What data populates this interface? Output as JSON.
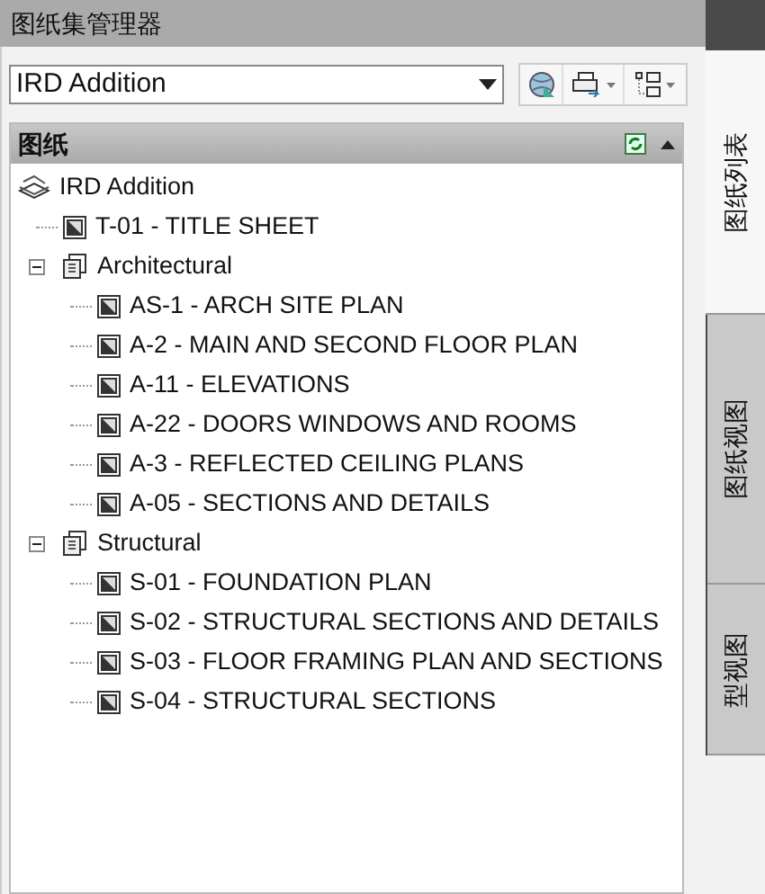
{
  "window": {
    "title": "图纸集管理器"
  },
  "sheet_set_dropdown": {
    "value": "IRD Addition"
  },
  "panel": {
    "title": "图纸"
  },
  "tree": [
    {
      "kind": "set",
      "label": "IRD Addition",
      "children": [
        {
          "kind": "sheet",
          "label": "T-01 - TITLE SHEET"
        },
        {
          "kind": "subset",
          "label": "Architectural",
          "expanded": true,
          "children": [
            {
              "kind": "sheet",
              "label": "AS-1 - ARCH SITE PLAN"
            },
            {
              "kind": "sheet",
              "label": "A-2 - MAIN AND SECOND FLOOR PLAN"
            },
            {
              "kind": "sheet",
              "label": "A-11 - ELEVATIONS"
            },
            {
              "kind": "sheet",
              "label": "A-22 - DOORS WINDOWS AND ROOMS"
            },
            {
              "kind": "sheet",
              "label": "A-3 - REFLECTED CEILING PLANS"
            },
            {
              "kind": "sheet",
              "label": "A-05 - SECTIONS AND DETAILS"
            }
          ]
        },
        {
          "kind": "subset",
          "label": "Structural",
          "expanded": true,
          "children": [
            {
              "kind": "sheet",
              "label": "S-01 - FOUNDATION PLAN"
            },
            {
              "kind": "sheet",
              "label": "S-02 - STRUCTURAL SECTIONS AND DETAILS"
            },
            {
              "kind": "sheet",
              "label": "S-03 - FLOOR FRAMING PLAN AND SECTIONS"
            },
            {
              "kind": "sheet",
              "label": "S-04 - STRUCTURAL SECTIONS"
            }
          ]
        }
      ]
    }
  ],
  "side_tabs": [
    {
      "label": "图纸列表",
      "selected": true
    },
    {
      "label": "图纸视图",
      "selected": false
    },
    {
      "label": "型视图",
      "selected": false
    }
  ]
}
